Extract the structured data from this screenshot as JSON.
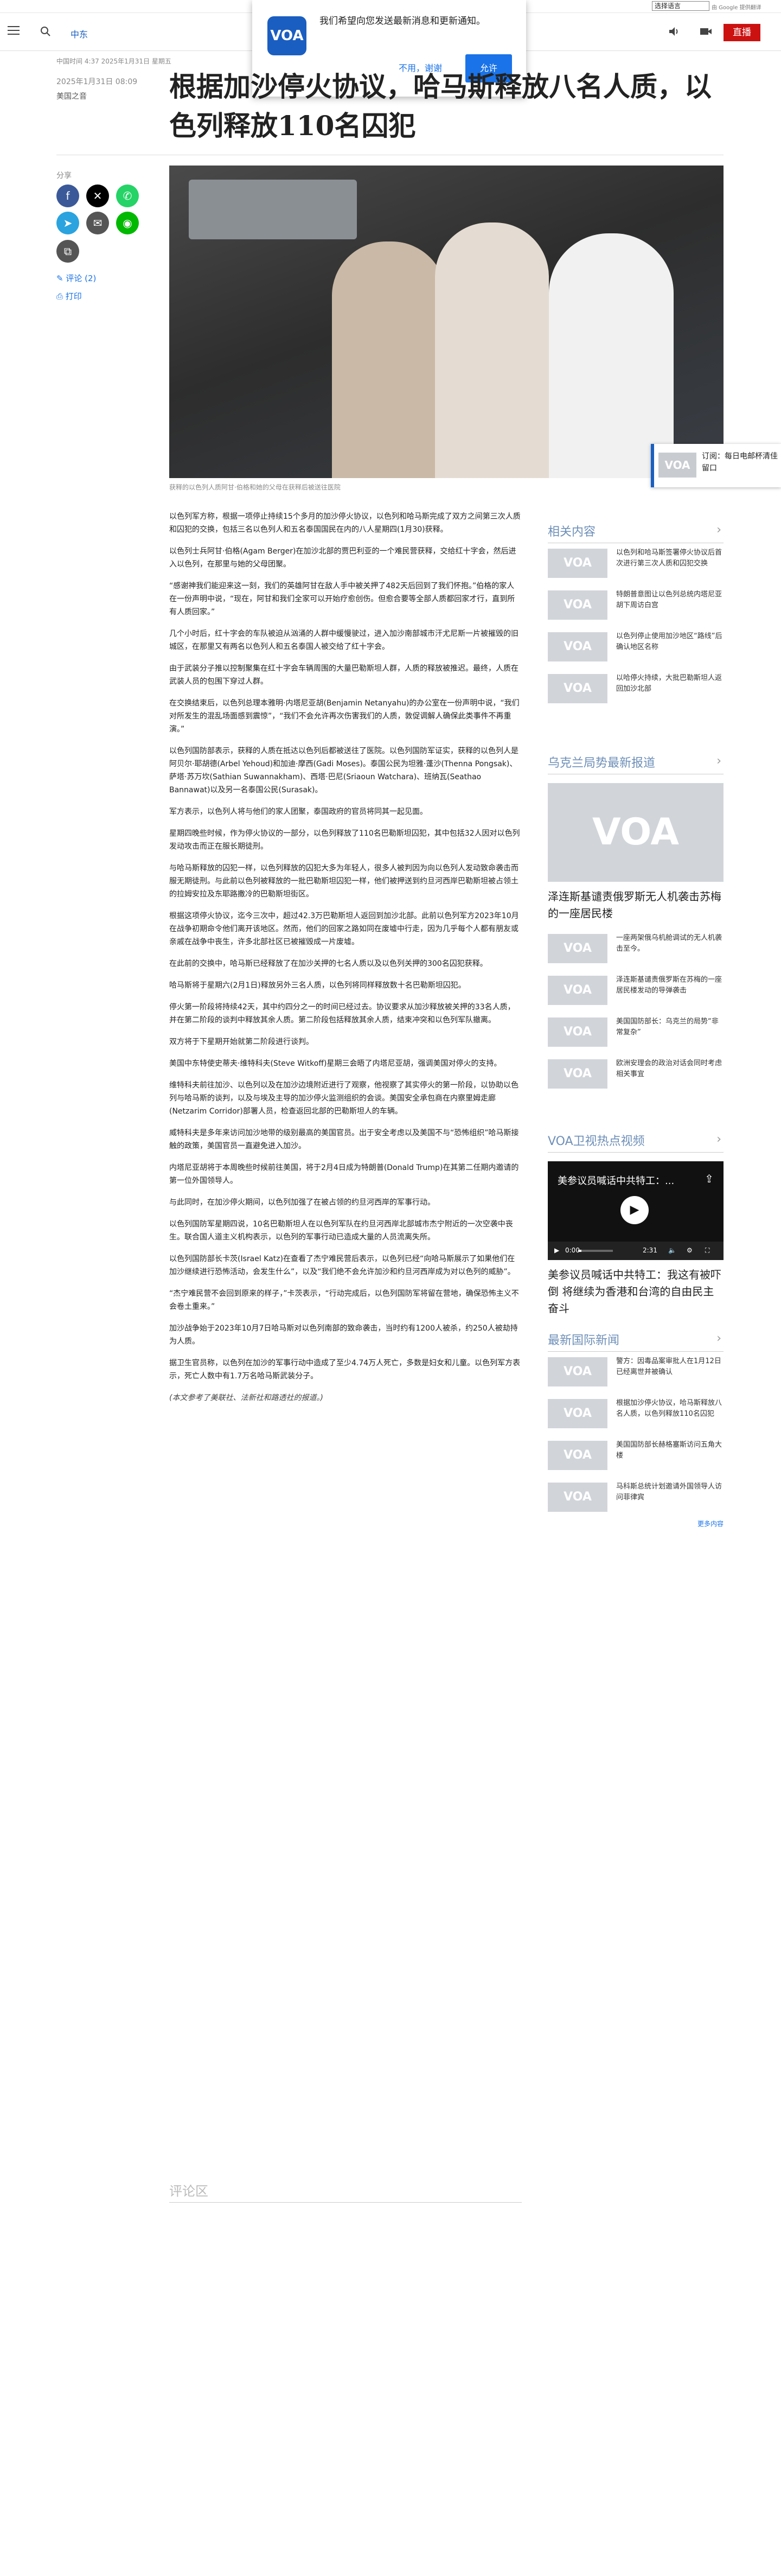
{
  "translate_bar": {
    "select_label": "选择语言",
    "credit": "由 Google 提供翻译"
  },
  "header": {
    "nav_label": "中东",
    "menu_icon": "hamburger-icon",
    "search_icon": "search-icon",
    "volume_icon": "volume-icon",
    "video_icon": "video-icon",
    "live_label": "直播",
    "accent": "#cc1111",
    "brand_color": "#1a5ec1"
  },
  "popup": {
    "logo_text": "VOA",
    "message": "我们希望向您发送最新消息和更新通知。",
    "no_label": "不用，谢谢",
    "yes_label": "允许"
  },
  "article_meta": {
    "top_note": "中国时间 4:37 2025年1月31日 星期五",
    "date": "2025年1月31日 08:09",
    "author": "美国之音"
  },
  "article": {
    "title": "根据加沙停火协议，哈马斯释放八名人质，以色列释放110名囚犯",
    "caption": "获释的以色列人质阿甘·伯格和她的父母在获释后被送往医院",
    "paragraphs": [
      "以色列军方称，根据一项停止持续15个多月的加沙停火协议，以色列和哈马斯完成了双方之间第三次人质和囚犯的交换，包括三名以色列人和五名泰国国民在内的八人星期四(1月30)获释。",
      "以色列士兵阿甘·伯格(Agam Berger)在加沙北部的贾巴利亚的一个难民营获释，交给红十字会，然后进入以色列，在那里与她的父母团聚。",
      "“感谢神我们能迎来这一刻，我们的英雄阿甘在敌人手中被关押了482天后回到了我们怀抱。”伯格的家人在一份声明中说，“现在，阿甘和我们全家可以开始疗愈创伤。但愈合要等全部人质都回家才行，直到所有人质回家。”",
      "几个小时后，红十字会的车队被迫从汹涌的人群中缓慢驶过，进入加沙南部城市汗尤尼斯一片被摧毁的旧城区，在那里又有两名以色列人和五名泰国人被交给了红十字会。",
      "由于武装分子推以控制聚集在红十字会车辆周围的大量巴勒斯坦人群，人质的释放被推迟。最终，人质在武装人员的包围下穿过人群。",
      "在交换结束后，以色列总理本雅明·内塔尼亚胡(Benjamin Netanyahu)的办公室在一份声明中说，“我们对所发生的混乱场面感到震惊”，“我们不会允许再次伤害我们的人质，敦促调解人确保此类事件不再重演。”",
      "以色列国防部表示，获释的人质在抵达以色列后都被送往了医院。以色列国防军证实，获释的以色列人是阿贝尔·耶胡德(Arbel Yehoud)和加迪·摩西(Gadi Moses)。泰国公民为坦雅·蓬沙(Thenna Pongsak)、萨塔·苏万坎(Sathian Suwannakham)、西塔·巴尼(Sriaoun Watchara)、班纳瓦(Seathao Bannawat)以及另一名泰国公民(Surasak)。",
      "军方表示，以色列人将与他们的家人团聚，泰国政府的官员将同其一起见面。",
      "星期四晚些时候，作为停火协议的一部分，以色列释放了110名巴勒斯坦囚犯，其中包括32人因对以色列发动攻击而正在服长期徒刑。",
      "与哈马斯释放的囚犯一样，以色列释放的囚犯大多为年轻人，很多人被判因为向以色列人发动致命袭击而服无期徒刑。与此前以色列被释放的一批巴勒斯坦囚犯一样，他们被押送到约旦河西岸巴勒斯坦被占领土的拉姆安拉及东耶路撒冷的巴勒斯坦街区。",
      "根据这项停火协议，迄今三次中，超过42.3万巴勒斯坦人返回到加沙北部。此前以色列军方2023年10月在战争初期命令他们离开该地区。然而，他们的回家之路如同在废墟中行走，因为几乎每个人都有朋友或亲戚在战争中丧生，许多北部社区已被摧毁成一片废墟。",
      "在此前的交换中，哈马斯已经释放了在加沙关押的七名人质以及以色列关押的300名囚犯获释。",
      "哈马斯将于星期六(2月1日)释放另外三名人质，以色列将同样释放数十名巴勒斯坦囚犯。",
      "停火第一阶段将持续42天，其中约四分之一的时间已经过去。协议要求从加沙释放被关押的33名人质，并在第二阶段的谈判中释放其余人质。第二阶段包括释放其余人质，结束冲突和以色列军队撤离。",
      "双方将于下星期开始就第二阶段进行谈判。",
      "美国中东特使史蒂夫·维特科夫(Steve Witkoff)星期三会晤了内塔尼亚胡，强调美国对停火的支持。",
      "维特科夫前往加沙、以色列以及在加沙边境附近进行了观察，他视察了其实停火的第一阶段，以协助以色列与哈马斯的谈判，以及与埃及主导的加沙停火监测组织的会谈。美国安全承包商在内察里姆走廊(Netzarim Corridor)部署人员，检查返回北部的巴勒斯坦人的车辆。",
      "威特科夫是多年来访问加沙地带的级别最高的美国官员。出于安全考虑以及美国不与“恐怖组织”哈马斯接触的政策，美国官员一直避免进入加沙。",
      "内塔尼亚胡将于本周晚些时候前往美国，将于2月4日成为特朗普(Donald Trump)在其第二任期内邀请的第一位外国领导人。",
      "与此同时，在加沙停火期间，以色列加强了在被占领的约旦河西岸的军事行动。",
      "以色列国防军星期四说，10名巴勒斯坦人在以色列军队在约旦河西岸北部城市杰宁附近的一次空袭中丧生。联合国人道主义机构表示，以色列的军事行动已造成大量的人员流离失所。",
      "以色列国防部长卡茨(Israel Katz)在查看了杰宁难民营后表示，以色列已经“向哈马斯展示了如果他们在加沙继续进行恐怖活动，会发生什么”，以及“我们绝不会允许加沙和约旦河西岸成为对以色列的威胁”。",
      "“杰宁难民营不会回到原来的样子，”卡茨表示，“行动完成后，以色列国防军将留在营地，确保恐怖主义不会卷土重来。”",
      "加沙战争始于2023年10月7日哈马斯对以色列南部的致命袭击，当时约有1200人被杀，约250人被劫持为人质。",
      "据卫生官员称，以色列在加沙的军事行动中造成了至少4.74万人死亡，多数是妇女和儿童。以色列军方表示，死亡人数中有1.7万名哈马斯武装分子。"
    ],
    "footnote": "(本文参考了美联社、法新社和路透社的报道。)",
    "comments_heading": "评论区"
  },
  "share": {
    "label": "分享",
    "comment_link": "评论 (2)",
    "print_link": "打印",
    "icons": [
      "facebook-icon",
      "x-icon",
      "whatsapp-icon",
      "telegram-icon",
      "email-icon",
      "line-icon",
      "copy-link-icon"
    ]
  },
  "sticky_player": {
    "text": "订阅：每日电邮杯清佳留口"
  },
  "sidebar": {
    "related_heading": "相关内容",
    "related": [
      "以色列和哈马斯签署停火协议后首次进行第三次人质和囚犯交换",
      "特朗普意图让以色列总统内塔尼亚胡下周访白宫",
      "以色列停止使用加沙地区“路线”后确认地区名称",
      "以哈停火持续，大批巴勒斯坦人返回加沙北部"
    ],
    "ukraine_heading": "乌克兰局势最新报道",
    "ukraine_feature": "泽连斯基谴责俄罗斯无人机袭击苏梅的一座居民楼",
    "ukraine": [
      "一座两架俄乌机舱调试的无人机袭击至今。",
      "泽连斯基谴责俄罗斯在苏梅的一座居民楼发动的导弹袭击",
      "美国国防部长：乌克兰的局势“非常复杂”",
      "欧洲安理会的政治对话会同时考虑相关事宜"
    ],
    "video_heading": "VOA卫视热点视频",
    "video": {
      "overlay_title": "美参议员喊话中共特工：...",
      "time_current": "0:00",
      "time_total": "2:31",
      "progress": 0.1
    },
    "video_caption": "美参议员喊话中共特工：我这有被吓倒 将继续为香港和台湾的自由民主奋斗",
    "intl_heading": "最新国际新闻",
    "intl": [
      "警方：因毒品案审批人在1月12日已经离世并被确认",
      "根据加沙停火协议，哈马斯释放八名人质，以色列释放110名囚犯",
      "美国国防部长赫格塞斯访问五角大楼",
      "马科斯总统计划邀请外国领导人访问菲律宾"
    ],
    "more_link": "更多内容"
  }
}
